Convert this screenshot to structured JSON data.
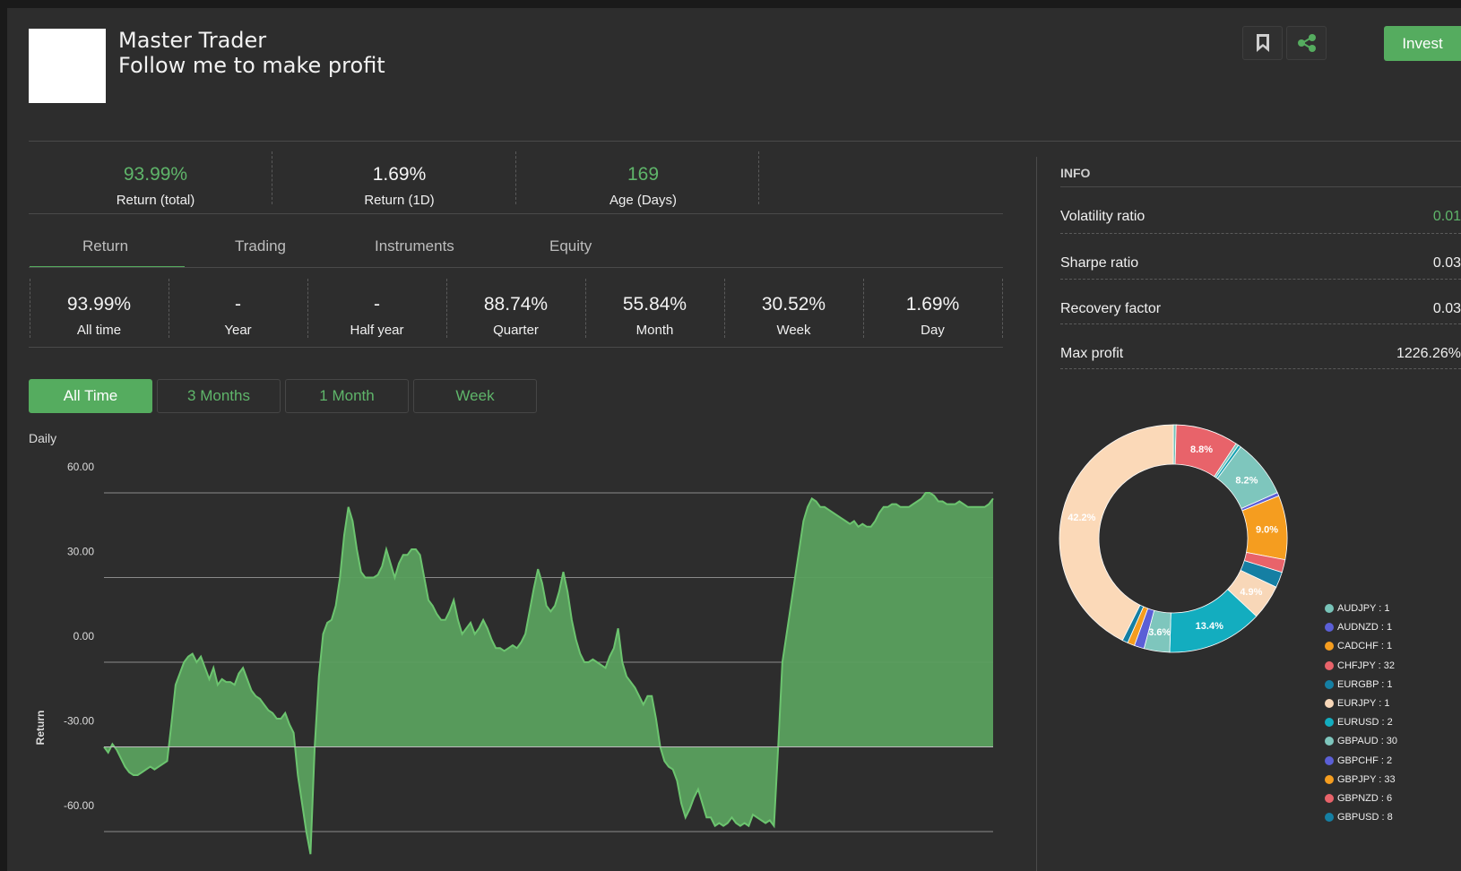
{
  "header": {
    "name": "Master Trader",
    "tagline": "Follow me to make profit",
    "invest_label": "Invest",
    "bookmark_icon": "bookmark-icon",
    "share_icon": "share-icon"
  },
  "top_stats": [
    {
      "value": "93.99%",
      "label": "Return (total)",
      "color": "#5fb56a"
    },
    {
      "value": "1.69%",
      "label": "Return (1D)",
      "color": "#f5f5f5"
    },
    {
      "value": "169",
      "label": "Age (Days)",
      "color": "#5fb56a"
    }
  ],
  "tabs": [
    {
      "label": "Return",
      "active": true
    },
    {
      "label": "Trading",
      "active": false
    },
    {
      "label": "Instruments",
      "active": false
    },
    {
      "label": "Equity",
      "active": false
    }
  ],
  "period_stats": [
    {
      "value": "93.99%",
      "label": "All time"
    },
    {
      "value": "-",
      "label": "Year"
    },
    {
      "value": "-",
      "label": "Half year"
    },
    {
      "value": "88.74%",
      "label": "Quarter"
    },
    {
      "value": "55.84%",
      "label": "Month"
    },
    {
      "value": "30.52%",
      "label": "Week"
    },
    {
      "value": "1.69%",
      "label": "Day"
    }
  ],
  "range_buttons": [
    {
      "label": "All Time",
      "active": true
    },
    {
      "label": "3 Months",
      "active": false
    },
    {
      "label": "1 Month",
      "active": false
    },
    {
      "label": "Week",
      "active": false
    }
  ],
  "info": {
    "heading": "INFO",
    "rows": [
      {
        "label": "Volatility ratio",
        "value": "0.01",
        "color": "#5fb56a"
      },
      {
        "label": "Sharpe ratio",
        "value": "0.03",
        "color": "#f0f0f0"
      },
      {
        "label": "Recovery factor",
        "value": "0.03",
        "color": "#f0f0f0"
      },
      {
        "label": "Max profit",
        "value": "1226.26%",
        "color": "#f0f0f0"
      }
    ]
  },
  "chart_data": [
    {
      "type": "area",
      "title": "Daily",
      "xlabel": "",
      "ylabel": "Return",
      "ylim": [
        -65,
        65
      ],
      "yticks": [
        "60.00",
        "30.00",
        "0.00",
        "-30.00",
        "-60.00"
      ],
      "ytick_values": [
        60,
        30,
        0,
        -30,
        -60
      ],
      "baseline": -30,
      "grid": true,
      "color": "#5aa05e",
      "series": [
        {
          "values": [
            -30,
            -32,
            -29,
            -31,
            -34,
            -37,
            -39,
            -40,
            -40,
            -39,
            -38,
            -37,
            -38,
            -37,
            -36,
            -35,
            -22,
            -8,
            -4,
            0,
            2,
            3,
            0,
            2,
            -2,
            -6,
            -2,
            -8,
            -6,
            -7,
            -7,
            -8,
            -4,
            -2,
            -6,
            -10,
            -12,
            -13,
            -15,
            -17,
            -18,
            -20,
            -20,
            -18,
            -22,
            -25,
            -40,
            -50,
            -60,
            -68,
            -30,
            -5,
            10,
            14,
            15,
            20,
            30,
            45,
            55,
            50,
            40,
            32,
            30,
            30,
            30,
            31,
            34,
            40,
            35,
            30,
            35,
            38,
            38,
            40,
            40,
            38,
            30,
            22,
            20,
            17,
            15,
            15,
            18,
            22,
            15,
            10,
            12,
            14,
            10,
            12,
            15,
            12,
            8,
            5,
            5,
            4,
            5,
            6,
            5,
            7,
            10,
            18,
            26,
            33,
            28,
            20,
            18,
            20,
            25,
            32,
            25,
            15,
            8,
            3,
            0,
            0,
            1,
            0,
            -1,
            -2,
            2,
            5,
            12,
            0,
            -5,
            -7,
            -9,
            -12,
            -15,
            -12,
            -12,
            -20,
            -30,
            -35,
            -37,
            -38,
            -42,
            -50,
            -55,
            -52,
            -48,
            -45,
            -50,
            -55,
            -55,
            -58,
            -57,
            -58,
            -57,
            -55,
            -57,
            -58,
            -57,
            -58,
            -54,
            -55,
            -56,
            -57,
            -56,
            -58,
            -30,
            0,
            10,
            20,
            30,
            40,
            50,
            55,
            58,
            57,
            55,
            55,
            54,
            53,
            52,
            51,
            50,
            49,
            50,
            48,
            49,
            48,
            48,
            50,
            53,
            55,
            55,
            56,
            56,
            55,
            55,
            55,
            56,
            57,
            58,
            60,
            60,
            59,
            57,
            57,
            56,
            56,
            56,
            57,
            56,
            55,
            55,
            55,
            55,
            55,
            56,
            58
          ]
        }
      ]
    },
    {
      "type": "pie",
      "title": "",
      "donut": true,
      "slices": [
        {
          "label": "",
          "value": 0.4,
          "color": "#78c3b8"
        },
        {
          "label": "8.8%",
          "value": 8.8,
          "color": "#e8636a"
        },
        {
          "label": "",
          "value": 0.4,
          "color": "#7dc4bb"
        },
        {
          "label": "",
          "value": 0.4,
          "color": "#16a2b2"
        },
        {
          "label": "8.2%",
          "value": 8.2,
          "color": "#7ec6bd"
        },
        {
          "label": "",
          "value": 0.5,
          "color": "#5b5fd6"
        },
        {
          "label": "9.0%",
          "value": 9.0,
          "color": "#f59d1f"
        },
        {
          "label": "",
          "value": 1.8,
          "color": "#e8636a"
        },
        {
          "label": "",
          "value": 2.2,
          "color": "#157fa3"
        },
        {
          "label": "4.9%",
          "value": 4.9,
          "color": "#f8d7b8"
        },
        {
          "label": "13.4%",
          "value": 13.4,
          "color": "#13adbf"
        },
        {
          "label": "3.6%",
          "value": 3.6,
          "color": "#7ec6bd"
        },
        {
          "label": "",
          "value": 1.4,
          "color": "#5b5fd6"
        },
        {
          "label": "",
          "value": 1.0,
          "color": "#f59d1f"
        },
        {
          "label": "",
          "value": 0.8,
          "color": "#157fa3"
        },
        {
          "label": "42.2%",
          "value": 42.2,
          "color": "#fbd9b8"
        }
      ],
      "legend": [
        {
          "label": "AUDJPY : 1",
          "color": "#78c3b8"
        },
        {
          "label": "AUDNZD : 1",
          "color": "#5b5fd6"
        },
        {
          "label": "CADCHF : 1",
          "color": "#f59d1f"
        },
        {
          "label": "CHFJPY : 32",
          "color": "#e8636a"
        },
        {
          "label": "EURGBP : 1",
          "color": "#157fa3"
        },
        {
          "label": "EURJPY : 1",
          "color": "#f8d7b8"
        },
        {
          "label": "EURUSD : 2",
          "color": "#13adbf"
        },
        {
          "label": "GBPAUD : 30",
          "color": "#7ec6bd"
        },
        {
          "label": "GBPCHF : 2",
          "color": "#5b5fd6"
        },
        {
          "label": "GBPJPY : 33",
          "color": "#f59d1f"
        },
        {
          "label": "GBPNZD : 6",
          "color": "#e8636a"
        },
        {
          "label": "GBPUSD : 8",
          "color": "#157fa3"
        }
      ]
    }
  ]
}
